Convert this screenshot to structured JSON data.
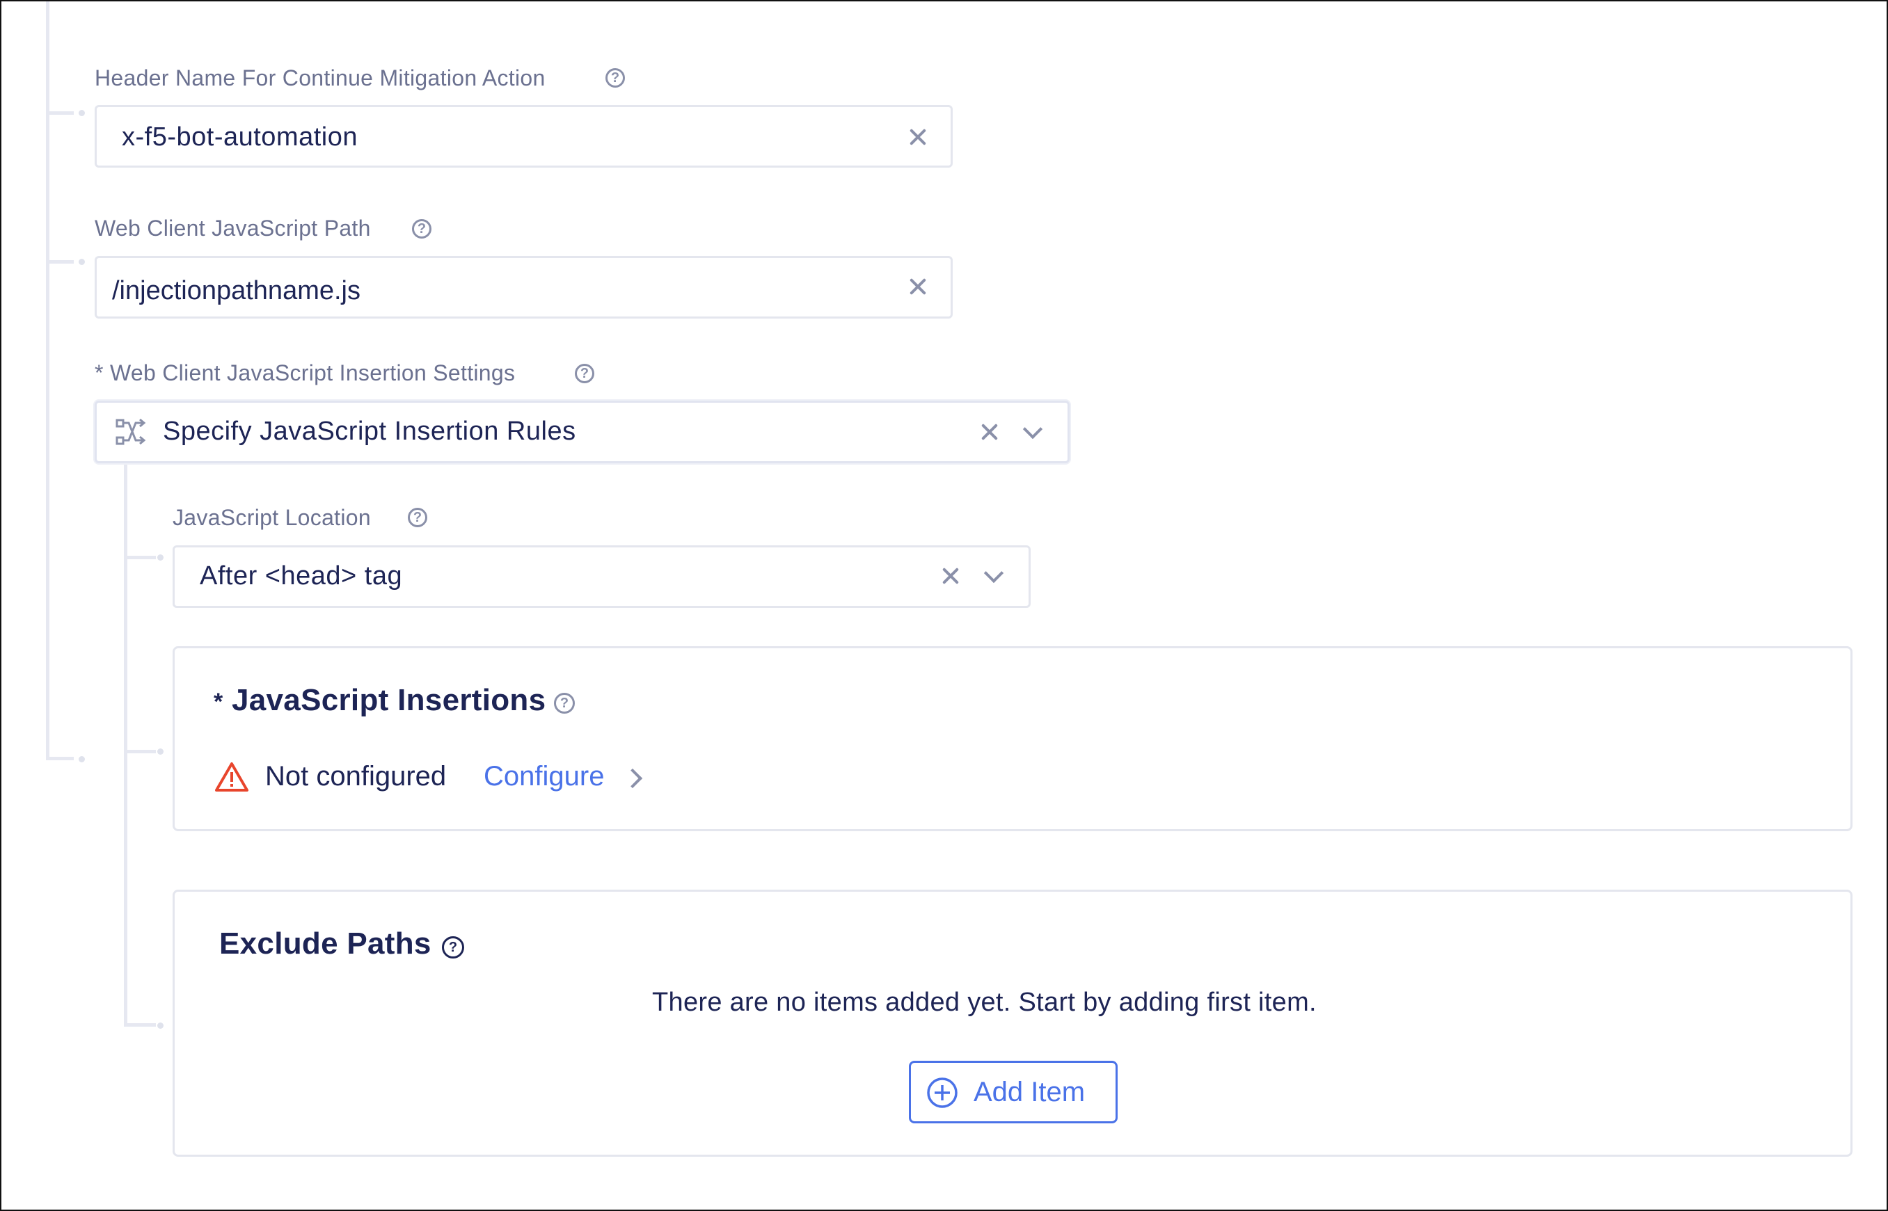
{
  "fields": {
    "header_name": {
      "label": "Header Name For Continue Mitigation Action",
      "value": "x-f5-bot-automation"
    },
    "js_path": {
      "label": "Web Client JavaScript Path",
      "value": "/injectionpathname.js"
    },
    "insertion_settings": {
      "label": "* Web Client JavaScript Insertion Settings",
      "value": "Specify JavaScript Insertion Rules",
      "icon": "flow-icon"
    },
    "js_location": {
      "label": "JavaScript Location",
      "value": "After <head> tag"
    }
  },
  "insertions_card": {
    "required_mark": "*",
    "title": "JavaScript Insertions",
    "status_icon": "warning-icon",
    "status_text": "Not configured",
    "link_label": "Configure"
  },
  "exclude_paths_card": {
    "title": "Exclude Paths",
    "empty_message": "There are no items added yet. Start by adding first item.",
    "add_button_label": "Add Item"
  },
  "colors": {
    "text_primary": "#1d2455",
    "label": "#6b7190",
    "accent": "#4a72e8",
    "warning": "#e8452c",
    "border": "#e4e6ee"
  }
}
